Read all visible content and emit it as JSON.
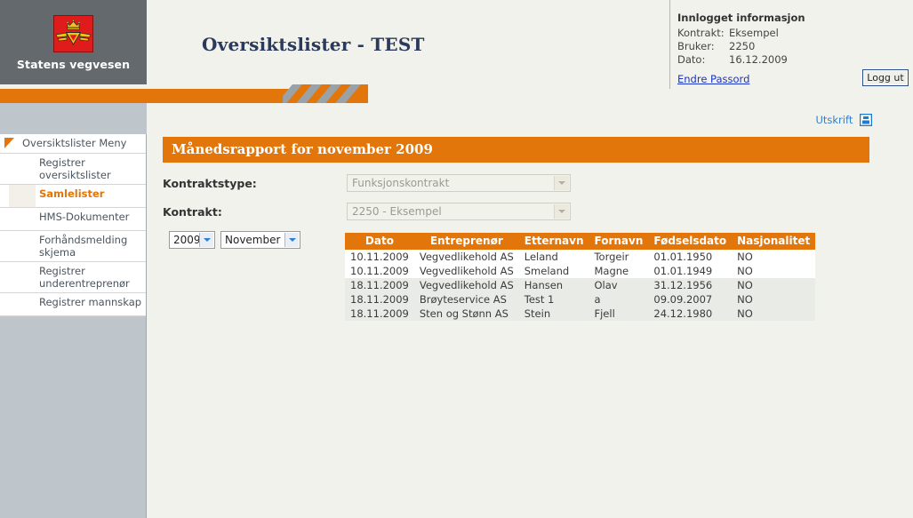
{
  "header": {
    "org_name": "Statens vegvesen",
    "app_title": "Oversiktslister - TEST",
    "logo_icon": "vegvesen-crown-wing-logo"
  },
  "login_info": {
    "title": "Innlogget informasjon",
    "kontrakt_label": "Kontrakt:",
    "kontrakt_value": "Eksempel",
    "bruker_label": "Bruker:",
    "bruker_value": "2250",
    "dato_label": "Dato:",
    "dato_value": "16.12.2009",
    "change_password_link": "Endre Passord",
    "logout_button": "Logg ut"
  },
  "sidebar": {
    "menu_header": "Oversiktslister Meny",
    "items": [
      {
        "label": "Registrer oversiktslister",
        "active": false
      },
      {
        "label": "Samlelister",
        "active": true
      },
      {
        "label": "HMS-Dokumenter",
        "active": false
      },
      {
        "label": "Forhåndsmelding skjema",
        "active": false
      },
      {
        "label": "Registrer underentreprenør",
        "active": false
      },
      {
        "label": "Registrer mannskap",
        "active": false
      }
    ]
  },
  "main": {
    "print_link": "Utskrift",
    "print_icon": "printer-icon",
    "panel_title": "Månedsrapport for november 2009",
    "kontraktstype_label": "Kontraktstype:",
    "kontraktstype_value": "Funksjonskontrakt",
    "kontrakt_label": "Kontrakt:",
    "kontrakt_value": "2250 - Eksempel",
    "year_value": "2009",
    "month_value": "November"
  },
  "table": {
    "columns": [
      "Dato",
      "Entreprenør",
      "Etternavn",
      "Fornavn",
      "Fødselsdato",
      "Nasjonalitet"
    ],
    "rows": [
      {
        "dato": "10.11.2009",
        "entreprenor": "Vegvedlikehold AS",
        "etternavn": "Leland",
        "fornavn": "Torgeir",
        "fodselsdato": "01.01.1950",
        "nasjonalitet": "NO"
      },
      {
        "dato": "10.11.2009",
        "entreprenor": "Vegvedlikehold AS",
        "etternavn": "Smeland",
        "fornavn": "Magne",
        "fodselsdato": "01.01.1949",
        "nasjonalitet": "NO"
      },
      {
        "dato": "18.11.2009",
        "entreprenor": "Vegvedlikehold AS",
        "etternavn": "Hansen",
        "fornavn": "Olav",
        "fodselsdato": "31.12.1956",
        "nasjonalitet": "NO"
      },
      {
        "dato": "18.11.2009",
        "entreprenor": "Brøyteservice AS",
        "etternavn": "Test 1",
        "fornavn": "a",
        "fodselsdato": "09.09.2007",
        "nasjonalitet": "NO"
      },
      {
        "dato": "18.11.2009",
        "entreprenor": "Sten og Stønn AS",
        "etternavn": "Stein",
        "fornavn": "Fjell",
        "fodselsdato": "24.12.1980",
        "nasjonalitet": "NO"
      }
    ]
  },
  "colors": {
    "accent_orange": "#e2760a",
    "header_grey": "#64696e",
    "sidebar_grey": "#bfc6cb",
    "page_bg": "#f2f2ec",
    "link_blue": "#1a34c8",
    "logo_red": "#e01b1b"
  }
}
